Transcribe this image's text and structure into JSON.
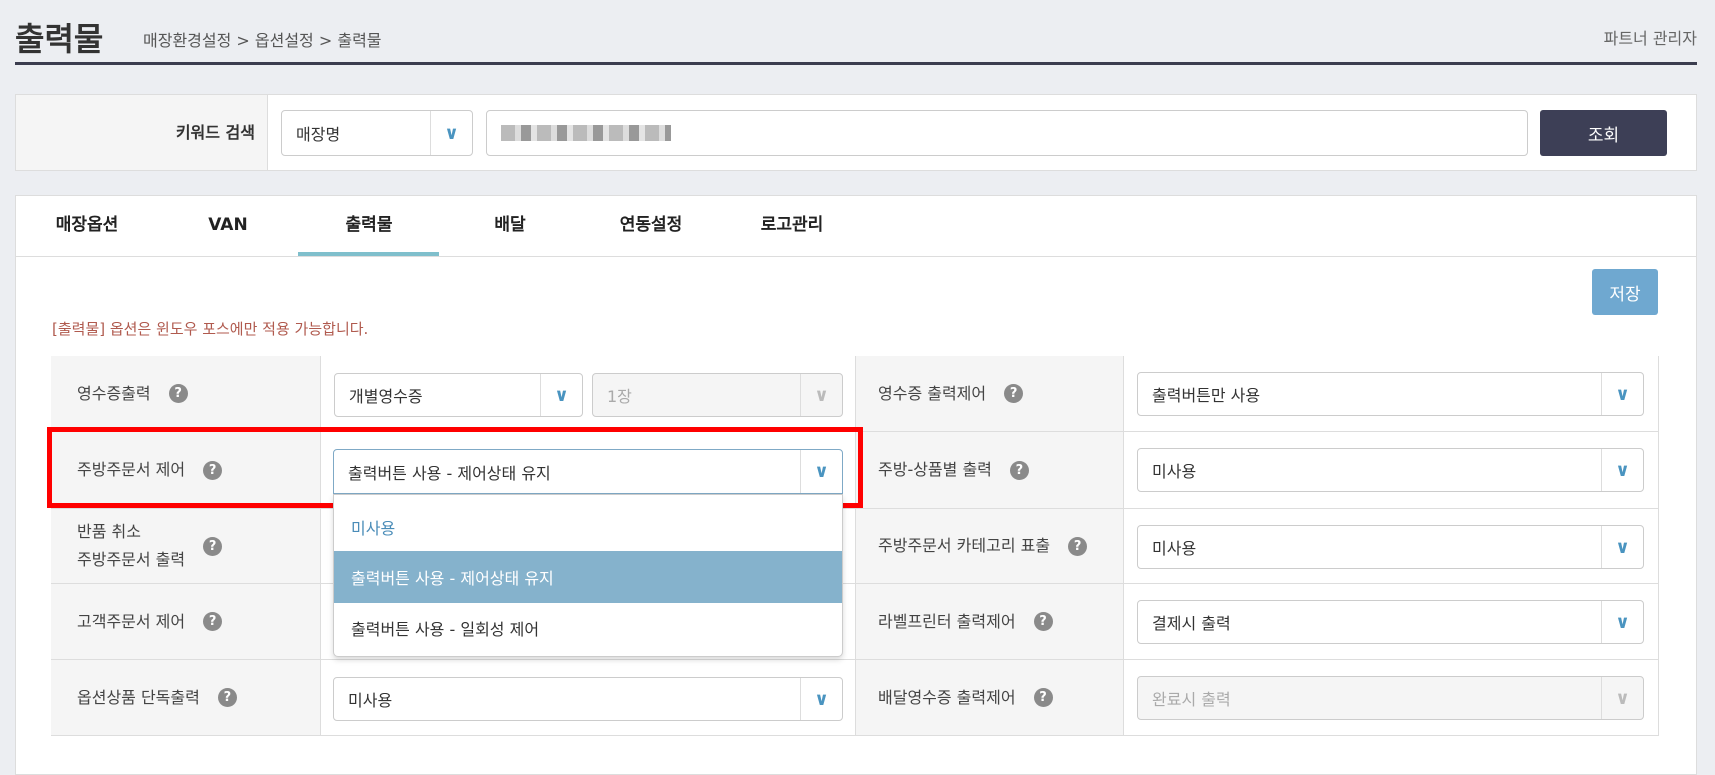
{
  "header": {
    "title": "출력물",
    "breadcrumb": "매장환경설정 > 옵션설정 > 출력물",
    "user": "파트너 관리자"
  },
  "search": {
    "label": "키워드 검색",
    "type_value": "매장명",
    "keyword_value": "(blurred)",
    "button": "조회"
  },
  "tabs": [
    {
      "label": "매장옵션"
    },
    {
      "label": "VAN"
    },
    {
      "label": "출력물",
      "active": true
    },
    {
      "label": "배달"
    },
    {
      "label": "연동설정"
    },
    {
      "label": "로고관리"
    }
  ],
  "save_label": "저장",
  "notice": "[출력물] 옵션은 윈도우 포스에만 적용 가능합니다.",
  "help_glyph": "?",
  "left_rows": [
    {
      "label": "영수증출력",
      "value": "개별영수증",
      "value2": "1장"
    },
    {
      "label": "주방주문서 제어",
      "value": "출력버튼 사용 - 제어상태 유지"
    },
    {
      "label": "반품 취소\n주방주문서 출력",
      "value": ""
    },
    {
      "label": "고객주문서 제어",
      "value": ""
    },
    {
      "label": "옵션상품 단독출력",
      "value": "미사용"
    }
  ],
  "right_rows": [
    {
      "label": "영수증 출력제어",
      "value": "출력버튼만 사용"
    },
    {
      "label": "주방-상품별 출력",
      "value": "미사용"
    },
    {
      "label": "주방주문서 카테고리 표출",
      "value": "미사용"
    },
    {
      "label": "라벨프린터 출력제어",
      "value": "결제시 출력"
    },
    {
      "label": "배달영수증 출력제어",
      "value": "완료시 출력",
      "disabled": true
    }
  ],
  "dropdown": {
    "options": [
      "미사용",
      "출력버튼 사용 - 제어상태 유지",
      "출력버튼 사용 - 일회성 제어"
    ],
    "selected_index": 1
  },
  "colors": {
    "accent": "#7fbfcc",
    "search_button": "#3d3f56",
    "save_button": "#6fa8d0",
    "highlight": "#85b2cc",
    "notice": "#b05a4e",
    "annotation": "#ff0000"
  }
}
